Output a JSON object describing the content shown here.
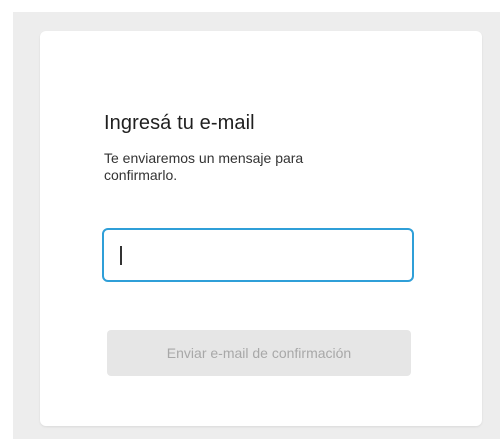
{
  "form": {
    "title": "Ingresá tu e-mail",
    "subtitle": "Te enviaremos un mensaje para confirmarlo.",
    "email_value": "",
    "email_placeholder": "",
    "submit_label": "Enviar e-mail de confirmación",
    "submit_enabled": false
  },
  "colors": {
    "background": "#ededed",
    "card": "#ffffff",
    "input_focus_border": "#2f9fd8",
    "button_disabled_bg": "#e6e6e6",
    "button_disabled_text": "#a8a8a8"
  }
}
